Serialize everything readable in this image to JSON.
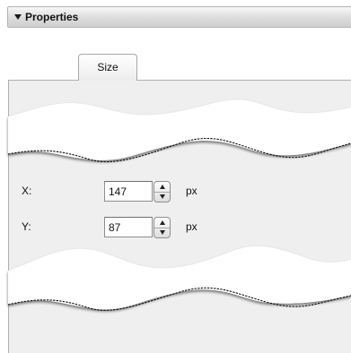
{
  "section": {
    "title": "Properties",
    "collapse_icon": "disclosure-triangle-down-icon"
  },
  "tabs": [
    {
      "label": "Size"
    }
  ],
  "fields": [
    {
      "label": "X:",
      "value": "147",
      "unit": "px"
    },
    {
      "label": "Y:",
      "value": "87",
      "unit": "px"
    }
  ],
  "colors": {
    "header_gradient_top": "#f7f7f7",
    "header_gradient_bottom": "#cfcfcf",
    "panel_background": "#efefef"
  }
}
